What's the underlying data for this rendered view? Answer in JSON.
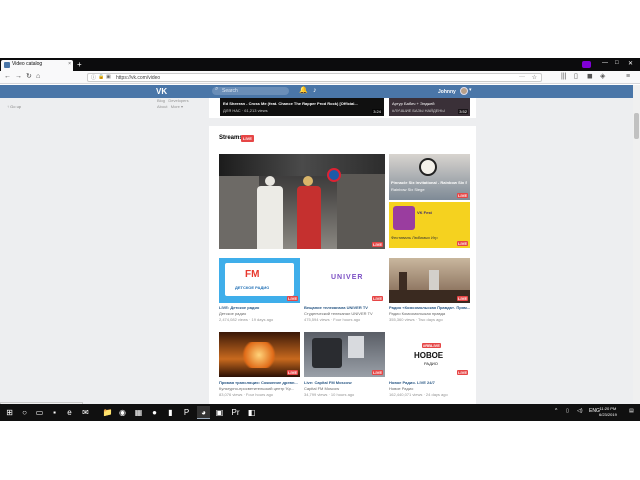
{
  "browser": {
    "tab_title": "Video catalog",
    "tab_close": "×",
    "new_tab": "+",
    "url": "https://vk.com/video",
    "status_url": "https://vk.com/video-49893935_456239175"
  },
  "vk": {
    "logo": "VK",
    "search_placeholder": "Search",
    "user_name": "Johnny",
    "back_link": "Go up",
    "footer": {
      "row1": [
        "Blog",
        "Developers"
      ],
      "row2": [
        "About",
        "More ▾"
      ]
    }
  },
  "top_videos": [
    {
      "title": "Ed Sheeran - Cross Me (feat. Chance The Rapper Prod Rock) [Official...",
      "meta": "ДЛЯ НАС · 61,213 views",
      "duration": "3:24"
    },
    {
      "title": "Артур Бабич + Элджей",
      "meta": "#ЛУЧШИЕ БАЗЫ НАЙДЕНЫ",
      "duration": "3:52"
    }
  ],
  "streams": {
    "heading": "Streams",
    "live_label": "LIVE",
    "featured": {
      "live_label": "LIVE"
    },
    "side": [
      {
        "title": "Pinnacle Six Invitational - Rainbow Six Siege Pro League Ru",
        "sub": "Rainbow Six Siege"
      },
      {
        "title": "Фестиваль Любимых Игр",
        "sub": "VK Fest"
      }
    ],
    "grid": [
      {
        "thumb_text": "FM",
        "thumb_sub": "ДЕТСКОЕ РАДИО",
        "title": "LIVE: Детское радио",
        "sub": "Детское радио",
        "meta": "2,474,082 views · 19 days ago"
      },
      {
        "thumb_text": "UNIVER",
        "title": "Вещание телеканала UNIVER TV",
        "sub": "Студенческий телеканал UNIVER TV",
        "meta": "475,594 views · Four hours ago"
      },
      {
        "title": "Радио «Комсомольская Правда». Прям...",
        "sub": "Радио Комсомольская правда",
        "meta": "355,360 views · Two days ago"
      },
      {
        "title": "Прямая трансляция: Сожжение древн...",
        "sub": "Культурно-просветительский центр 'Кр...",
        "meta": "83,076 views · Four hours ago"
      },
      {
        "title": "Live: Capital FM Moscow",
        "sub": "Capital FM Moscow",
        "meta": "34,799 views · 10 hours ago"
      },
      {
        "thumb_badge": "#RBLIVE",
        "thumb_text": "НОВОЕ",
        "thumb_sub": "РАДИО",
        "title": "Новое Радио. LIVE 24/7",
        "sub": "Новое Радио",
        "meta": "162,440,071 views · 24 days ago"
      }
    ]
  },
  "taskbar": {
    "lang": "ENG",
    "time": "11:20 PM",
    "date": "6/23/2019"
  },
  "colors": {
    "vk_blue": "#4a76a8",
    "link": "#2a5885",
    "live_red": "#e64646",
    "page_bg": "#edeef0"
  }
}
